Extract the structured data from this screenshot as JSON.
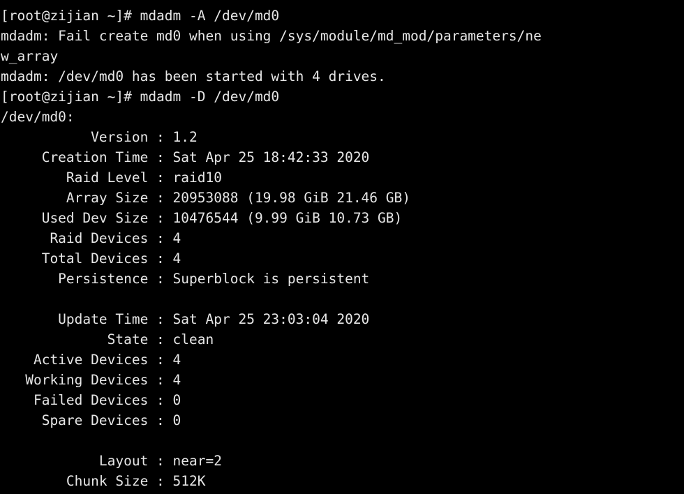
{
  "terminal": {
    "title": "root@zijian:~",
    "colors": {
      "background": "#000000",
      "foreground": "#e6e6e6"
    },
    "columns": 80,
    "prompt": "[root@zijian ~]# ",
    "clipped_top_line": "",
    "lines": [
      {
        "id": "cmd-assemble",
        "text": "[root@zijian ~]# mdadm -A /dev/md0"
      },
      {
        "id": "err-fail-create",
        "text": "mdadm: Fail create md0 when using /sys/module/md_mod/parameters/ne"
      },
      {
        "id": "err-fail-create-wrap",
        "text": "w_array"
      },
      {
        "id": "msg-started",
        "text": "mdadm: /dev/md0 has been started with 4 drives."
      },
      {
        "id": "cmd-detail",
        "text": "[root@zijian ~]# mdadm -D /dev/md0"
      },
      {
        "id": "device-header",
        "text": "/dev/md0:"
      },
      {
        "id": "row-version",
        "text": "           Version : 1.2"
      },
      {
        "id": "row-creation-time",
        "text": "     Creation Time : Sat Apr 25 18:42:33 2020"
      },
      {
        "id": "row-raid-level",
        "text": "        Raid Level : raid10"
      },
      {
        "id": "row-array-size",
        "text": "        Array Size : 20953088 (19.98 GiB 21.46 GB)"
      },
      {
        "id": "row-used-dev-size",
        "text": "     Used Dev Size : 10476544 (9.99 GiB 10.73 GB)"
      },
      {
        "id": "row-raid-devices",
        "text": "      Raid Devices : 4"
      },
      {
        "id": "row-total-devices",
        "text": "     Total Devices : 4"
      },
      {
        "id": "row-persistence",
        "text": "       Persistence : Superblock is persistent"
      },
      {
        "id": "blank-1",
        "text": ""
      },
      {
        "id": "row-update-time",
        "text": "       Update Time : Sat Apr 25 23:03:04 2020"
      },
      {
        "id": "row-state",
        "text": "             State : clean"
      },
      {
        "id": "row-active-devices",
        "text": "    Active Devices : 4"
      },
      {
        "id": "row-working-devices",
        "text": "   Working Devices : 4"
      },
      {
        "id": "row-failed-devices",
        "text": "    Failed Devices : 0"
      },
      {
        "id": "row-spare-devices",
        "text": "     Spare Devices : 0"
      },
      {
        "id": "blank-2",
        "text": ""
      },
      {
        "id": "row-layout",
        "text": "            Layout : near=2"
      },
      {
        "id": "row-chunk-size",
        "text": "        Chunk Size : 512K"
      }
    ],
    "detail": {
      "device": "/dev/md0",
      "version": "1.2",
      "creation_time": "Sat Apr 25 18:42:33 2020",
      "raid_level": "raid10",
      "array_size": "20953088 (19.98 GiB 21.46 GB)",
      "used_dev_size": "10476544 (9.99 GiB 10.73 GB)",
      "raid_devices": "4",
      "total_devices": "4",
      "persistence": "Superblock is persistent",
      "update_time": "Sat Apr 25 23:03:04 2020",
      "state": "clean",
      "active_devices": "4",
      "working_devices": "4",
      "failed_devices": "0",
      "spare_devices": "0",
      "layout": "near=2",
      "chunk_size": "512K"
    },
    "commands": [
      {
        "id": "assemble",
        "text": "mdadm -A /dev/md0"
      },
      {
        "id": "detail",
        "text": "mdadm -D /dev/md0"
      }
    ],
    "messages": [
      {
        "id": "fail-create",
        "text": "mdadm: Fail create md0 when using /sys/module/md_mod/parameters/new_array"
      },
      {
        "id": "started",
        "text": "mdadm: /dev/md0 has been started with 4 drives."
      }
    ]
  }
}
